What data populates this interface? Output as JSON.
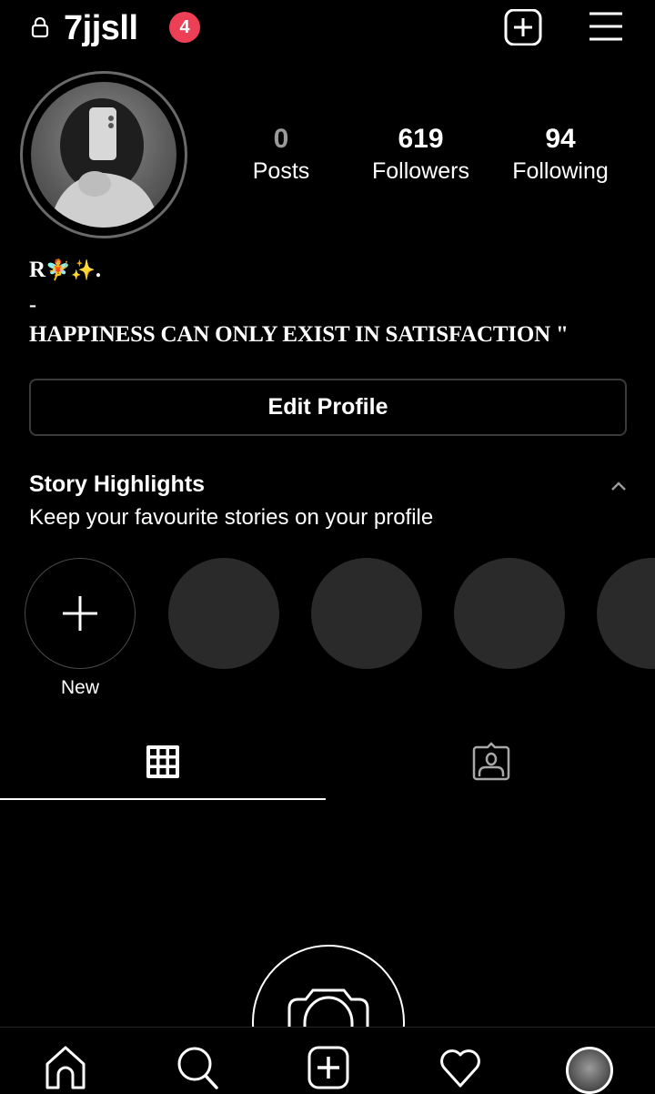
{
  "header": {
    "username": "7jjsll",
    "notification_count": "4",
    "lock_icon": "lock-icon",
    "new_post_icon": "plus-square-icon",
    "menu_icon": "hamburger-menu-icon"
  },
  "profile": {
    "stats": [
      {
        "value": "0",
        "label": "Posts"
      },
      {
        "value": "619",
        "label": "Followers"
      },
      {
        "value": "94",
        "label": "Following"
      }
    ],
    "bio": {
      "name": "R",
      "name_emoji_1": "🧚",
      "name_emoji_2": "✨",
      "name_suffix": ".",
      "separator": "-",
      "quote": "HAPPINESS CAN ONLY EXIST IN SATISFACTION \""
    },
    "edit_button_label": "Edit Profile"
  },
  "highlights": {
    "title": "Story Highlights",
    "subtitle": "Keep your favourite stories on your profile",
    "new_label": "New",
    "placeholder_count": 4
  },
  "tabs": [
    {
      "name": "posts-grid",
      "icon": "grid-icon",
      "active": true
    },
    {
      "name": "tagged",
      "icon": "tagged-person-icon",
      "active": false
    }
  ],
  "bottom_nav": [
    {
      "name": "home",
      "icon": "home-icon"
    },
    {
      "name": "search",
      "icon": "search-icon"
    },
    {
      "name": "create",
      "icon": "plus-square-icon"
    },
    {
      "name": "activity",
      "icon": "heart-icon"
    },
    {
      "name": "profile",
      "icon": "avatar"
    }
  ],
  "colors": {
    "background": "#000000",
    "badge": "#ed3f55",
    "highlight_placeholder": "#2a2a2a",
    "button_border": "#3a3a3a"
  }
}
